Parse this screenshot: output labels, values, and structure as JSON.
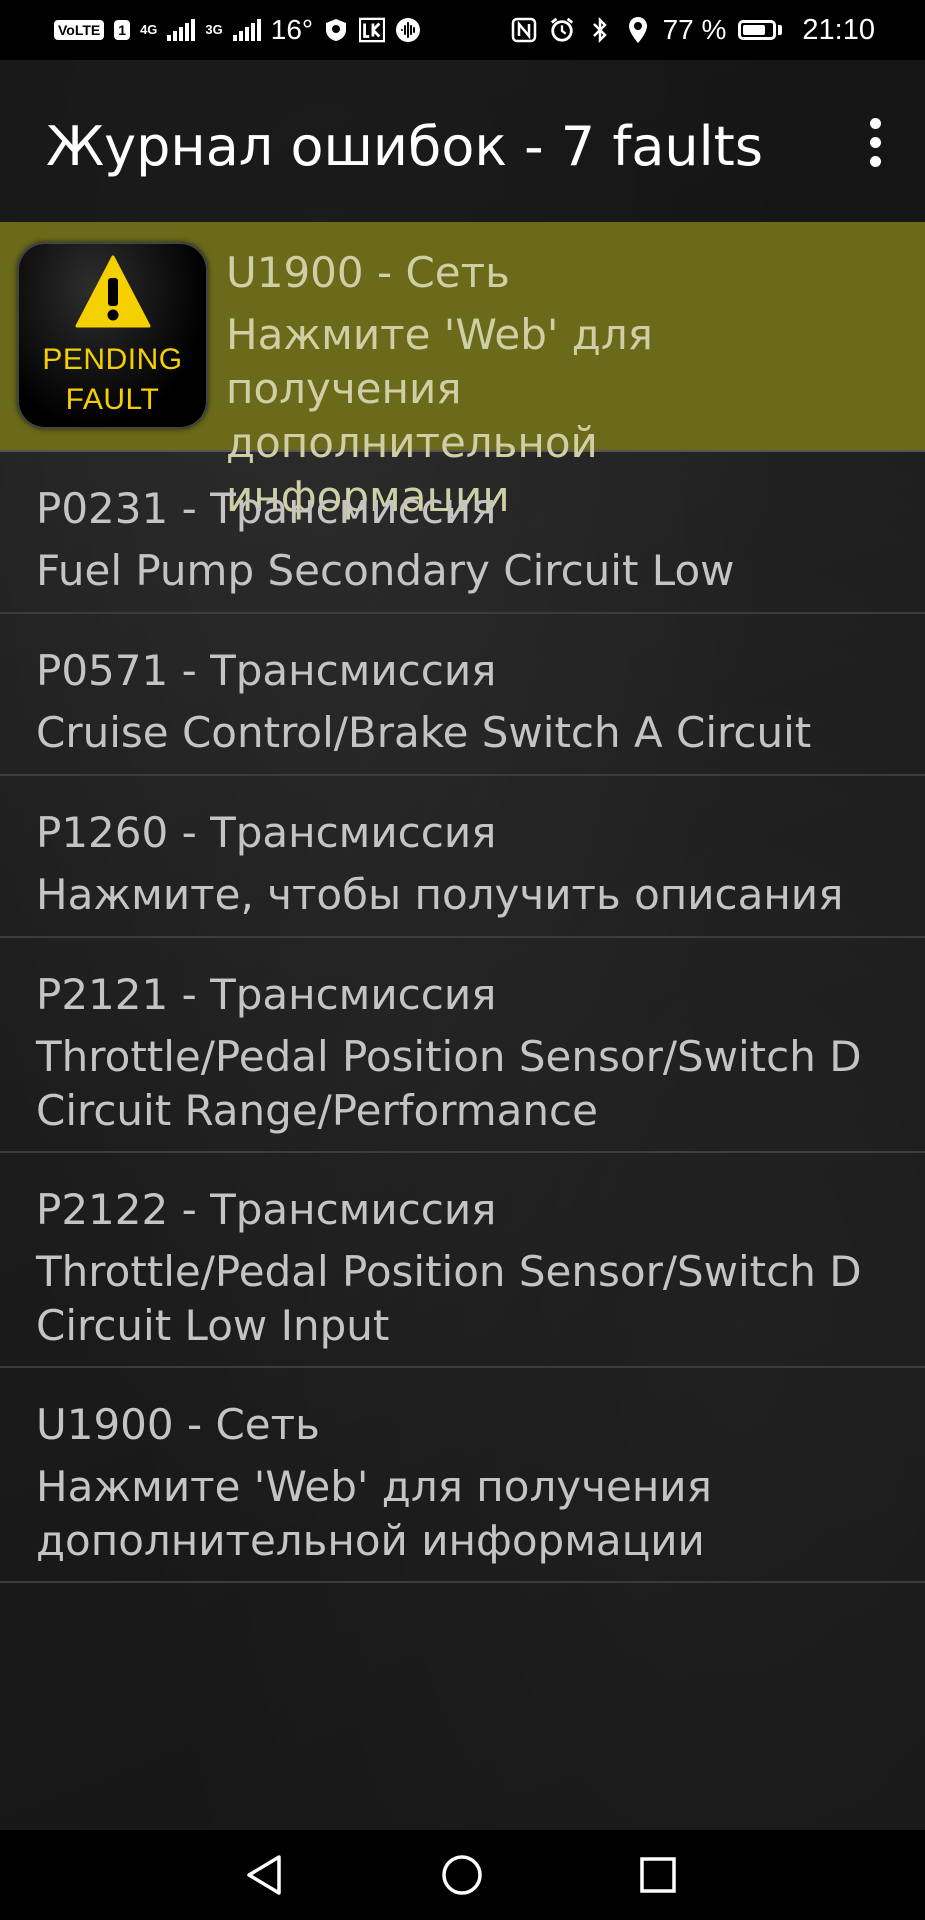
{
  "status_bar": {
    "volte_label": "VoLTE",
    "sim_label": "1",
    "net1_label": "4G",
    "net2_label": "3G",
    "temperature": "16°",
    "battery_percent": "77 %",
    "battery_level": 0.77,
    "time": "21:10"
  },
  "app_bar": {
    "title": "Журнал ошибок - 7 faults"
  },
  "pending_badge": {
    "line1": "PENDING",
    "line2": "FAULT",
    "accent": "#f5d000"
  },
  "faults": [
    {
      "code": "U1900 - Сеть",
      "description": "Нажмите 'Web' для получения\nдополнительной информации"
    },
    {
      "code": "P0231 - Трансмиссия",
      "description": "Fuel Pump Secondary Circuit Low"
    },
    {
      "code": "P0571 - Трансмиссия",
      "description": "Cruise Control/Brake Switch A Circuit"
    },
    {
      "code": "P1260 - Трансмиссия",
      "description": "Нажмите, чтобы получить описания"
    },
    {
      "code": "P2121 - Трансмиссия",
      "description": "Throttle/Pedal Position Sensor/Switch D\nCircuit Range/Performance"
    },
    {
      "code": "P2122 - Трансмиссия",
      "description": "Throttle/Pedal Position Sensor/Switch D\nCircuit Low Input"
    },
    {
      "code": "U1900 - Сеть",
      "description": "Нажмите 'Web' для получения\nдополнительной информации"
    }
  ],
  "colors": {
    "selected_row": "#6b6a1a",
    "row_text": "#c4c4c4",
    "divider": "#3c3c3c"
  }
}
